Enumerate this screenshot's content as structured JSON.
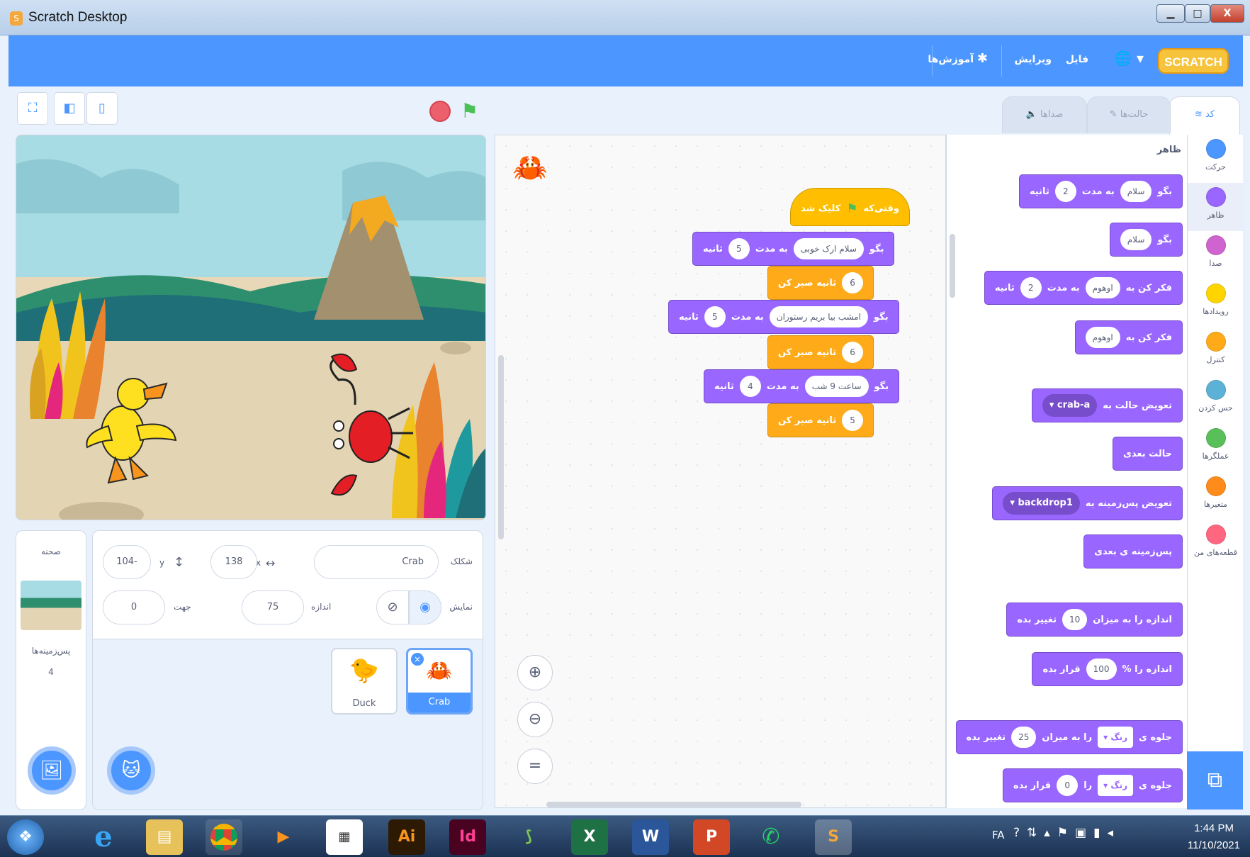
{
  "window": {
    "title": "Scratch Desktop",
    "minimize": "▁",
    "maximize": "□",
    "close": "X"
  },
  "menubar": {
    "logo": "SCRATCH",
    "file": "فایل",
    "edit": "ویرایش",
    "tutorials": "آموزش‌ها"
  },
  "tabs": {
    "code": "کد",
    "costumes": "حالت‌ها",
    "sounds": "صداها"
  },
  "categories": [
    {
      "label": "حرکت",
      "color": "#4c97ff"
    },
    {
      "label": "ظاهر",
      "color": "#9966ff"
    },
    {
      "label": "صدا",
      "color": "#cf63cf"
    },
    {
      "label": "رویدادها",
      "color": "#ffd500"
    },
    {
      "label": "کنترل",
      "color": "#ffab19"
    },
    {
      "label": "حس کردن",
      "color": "#5cb1d6"
    },
    {
      "label": "عملگرها",
      "color": "#59c059"
    },
    {
      "label": "متغیرها",
      "color": "#ff8c1a"
    },
    {
      "label": "قطعه‌های من",
      "color": "#ff6680"
    }
  ],
  "palette": {
    "section": "ظاهر",
    "b1": {
      "say": "بگو",
      "text": "سلام",
      "for": "به مدت",
      "n": "2",
      "sec": "ثانیه"
    },
    "b2": {
      "say": "بگو",
      "text": "سلام"
    },
    "b3": {
      "think": "فکر کن به",
      "text": "اوهوم",
      "for": "به مدت",
      "n": "2",
      "sec": "ثانیه"
    },
    "b4": {
      "think": "فکر کن به",
      "text": "اوهوم"
    },
    "b5": {
      "label": "تعویض حالت به",
      "val": "crab-a"
    },
    "b6": {
      "label": "حالت بعدی"
    },
    "b7": {
      "label": "تعویض پس‌زمینه به",
      "val": "backdrop1"
    },
    "b8": {
      "label": "پس‌زمینه ی بعدی"
    },
    "b9": {
      "label": "اندازه را به میزان",
      "n": "10",
      "tail": "تغییر بده"
    },
    "b10": {
      "label": "اندازه را %",
      "n": "100",
      "tail": "قرار بده"
    },
    "b11": {
      "label": "جلوه ی",
      "eff": "رنگ",
      "mid": "را به میزان",
      "n": "25",
      "tail": "تغییر بده"
    },
    "b12": {
      "label": "جلوه ی",
      "eff": "رنگ",
      "mid": "را",
      "n": "0",
      "tail": "قرار بده"
    }
  },
  "script": {
    "hat": "وقتی‌که",
    "hat_tail": "کلیک شد",
    "s1": {
      "say": "بگو",
      "text": "سلام ارک خوبی",
      "for": "به مدت",
      "n": "5",
      "sec": "ثانیه"
    },
    "w1": {
      "n": "6",
      "label": "ثانیه صبر کن"
    },
    "s2": {
      "say": "بگو",
      "text": "امشب بیا بریم رستوران",
      "for": "به مدت",
      "n": "5",
      "sec": "ثانیه"
    },
    "w2": {
      "n": "6",
      "label": "ثانیه صبر کن"
    },
    "s3": {
      "say": "بگو",
      "text": "ساعت 9 شب",
      "for": "به مدت",
      "n": "4",
      "sec": "ثانیه"
    },
    "w3": {
      "n": "5",
      "label": "ثانیه صبر کن"
    }
  },
  "sprite_info": {
    "sprite_label": "شکلک",
    "name": "Crab",
    "x_label": "x",
    "x": "138",
    "y_label": "y",
    "y": "104-",
    "show_label": "نمایش",
    "size_label": "اندازه",
    "size": "75",
    "dir_label": "جهت",
    "direction": "0"
  },
  "sprites": [
    {
      "name": "Duck"
    },
    {
      "name": "Crab"
    }
  ],
  "stage_panel": {
    "title": "صحنه",
    "backdrops_label": "پس‌زمینه‌ها",
    "backdrops_count": "4"
  },
  "taskbar": {
    "lang": "FA",
    "time": "1:44 PM",
    "date": "11/10/2021"
  }
}
